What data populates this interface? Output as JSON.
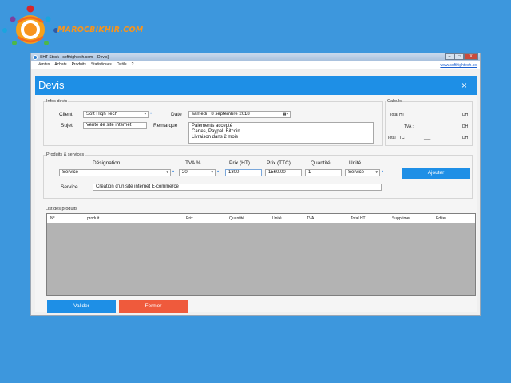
{
  "logo": {
    "text": "MAROCBIKHIR.COM"
  },
  "window": {
    "title": "SHT-Stock - softhightech.com - [Devis]",
    "controls": {
      "minimize": "–",
      "maximize": "□",
      "close": "X"
    }
  },
  "menu": {
    "items": [
      "Ventes",
      "Achats",
      "Produits",
      "Statistiques",
      "Outils",
      "?"
    ],
    "link": "www.softhightech.co"
  },
  "header": {
    "title": "Devis",
    "close": "×"
  },
  "infos": {
    "group_title": "Infos devis",
    "client_label": "Client",
    "client_value": "Soft High Tech",
    "date_label": "Date",
    "date_day": "samedi",
    "date_value": "8 septembre 2018",
    "sujet_label": "Sujet",
    "sujet_value": "Vente de site internet",
    "remarque_label": "Remarque",
    "remarque_lines": [
      "Paiements accepté",
      "Cartes, Paypal, Bitcoin",
      "Livraison dans 2 mois"
    ]
  },
  "calculs": {
    "group_title": "Calculs",
    "rows": [
      {
        "label": "Total HT :",
        "value": "___",
        "unit": "DH"
      },
      {
        "label": "TVA :",
        "value": "___",
        "unit": "DH"
      },
      {
        "label": "Total TTC :",
        "value": "___",
        "unit": "DH"
      }
    ]
  },
  "produits": {
    "group_title": "Produits & services",
    "headers": {
      "designation": "Désignation",
      "tva": "TVA %",
      "prix_ht": "Prix (HT)",
      "prix_ttc": "Prix (TTC)",
      "quantite": "Quantité",
      "unite": "Unité"
    },
    "designation_value": "Service",
    "tva_value": "20",
    "prix_ht_value": "1300",
    "prix_ttc_value": "1560.00",
    "quantite_value": "1",
    "unite_value": "Service",
    "ajouter_label": "Ajouter",
    "service_label": "Service",
    "service_value": "Création d'un site internet E-commerce"
  },
  "liste": {
    "title": "List des produits",
    "columns": [
      "N°",
      "produit",
      "Prix",
      "Quantité",
      "Unité",
      "TVA",
      "Total HT",
      "Supprimer",
      "Editer"
    ]
  },
  "actions": {
    "valider": "Valider",
    "fermer": "Fermer"
  },
  "colors": {
    "accent": "#1e8fe6",
    "danger": "#ef5a3c",
    "background": "#3d97dd",
    "logo": "#f7941d"
  },
  "icons": {
    "logo": "gear-cog-logo-icon",
    "app": "app-icon",
    "calendar": "calendar-icon",
    "dropdown": "chevron-down-icon"
  }
}
